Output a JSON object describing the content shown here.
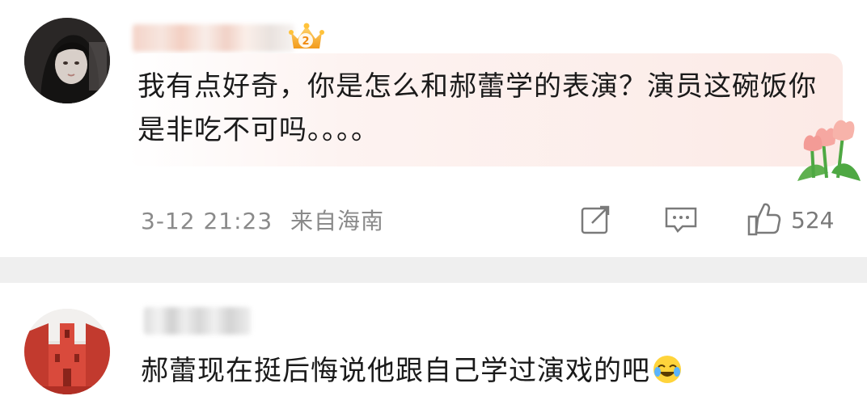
{
  "comments": [
    {
      "avatar_icon": "user-avatar-woman",
      "badge_icon": "vip-crown-badge",
      "badge_number": "2",
      "text": "我有点好奇，你是怎么和郝蕾学的表演？演员这碗饭你是非吃不可吗。。。。",
      "decor_icon": "tulip-flower-icon",
      "timestamp": "3-12 21:23",
      "location": "来自海南",
      "actions": {
        "share_icon": "share-edit-icon",
        "reply_icon": "comment-icon",
        "like_icon": "thumbs-up-icon",
        "like_count": "524"
      }
    },
    {
      "avatar_icon": "user-avatar-building",
      "text": "郝蕾现在挺后悔说他跟自己学过演戏的吧",
      "emoji": "laugh-cry-emoji"
    }
  ],
  "colors": {
    "divider": "#efefef",
    "meta_text": "#8a8a8a",
    "bubble": "#fceae6"
  }
}
